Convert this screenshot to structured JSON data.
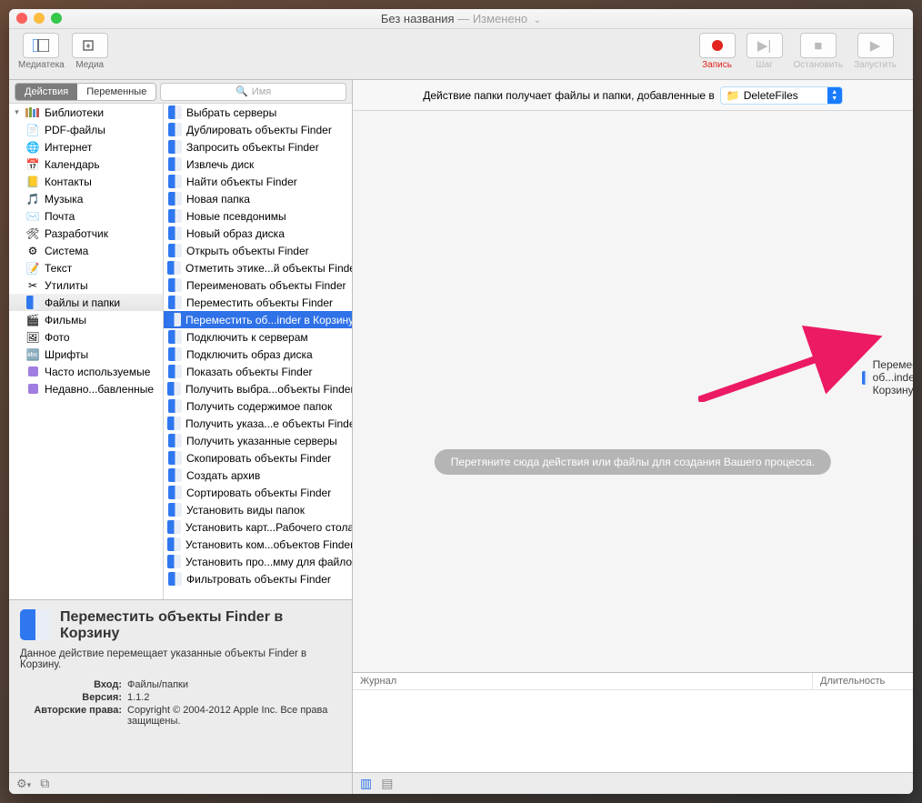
{
  "window": {
    "title": "Без названия",
    "subtitle": "— Изменено"
  },
  "toolbar": {
    "left": [
      {
        "id": "mediateka",
        "label": "Медиатека",
        "glyph": "layout"
      },
      {
        "id": "media",
        "label": "Медиа",
        "glyph": "media"
      }
    ],
    "right": [
      {
        "id": "record",
        "label": "Запись",
        "style": "rec"
      },
      {
        "id": "step",
        "label": "Шаг",
        "style": "dim"
      },
      {
        "id": "stop",
        "label": "Остановить",
        "style": "dim"
      },
      {
        "id": "run",
        "label": "Запустить",
        "style": "dim"
      }
    ]
  },
  "sidebar": {
    "tabs": {
      "actions": "Действия",
      "variables": "Переменные"
    },
    "search_placeholder": "Имя",
    "col1": {
      "header": "Библиотеки",
      "items": [
        {
          "label": "PDF-файлы",
          "ic": "📄"
        },
        {
          "label": "Интернет",
          "ic": "🌐"
        },
        {
          "label": "Календарь",
          "ic": "📅"
        },
        {
          "label": "Контакты",
          "ic": "📒"
        },
        {
          "label": "Музыка",
          "ic": "🎵"
        },
        {
          "label": "Почта",
          "ic": "✉️"
        },
        {
          "label": "Разработчик",
          "ic": "🛠"
        },
        {
          "label": "Система",
          "ic": "⚙"
        },
        {
          "label": "Текст",
          "ic": "📝"
        },
        {
          "label": "Утилиты",
          "ic": "✂"
        },
        {
          "label": "Файлы и папки",
          "ic": "finder",
          "selected": true
        },
        {
          "label": "Фильмы",
          "ic": "🎬"
        },
        {
          "label": "Фото",
          "ic": "🖼"
        },
        {
          "label": "Шрифты",
          "ic": "🔤"
        }
      ],
      "extra": [
        {
          "label": "Часто используемые"
        },
        {
          "label": "Недавно...бавленные"
        }
      ]
    },
    "col2": [
      "Выбрать серверы",
      "Дублировать объекты Finder",
      "Запросить объекты Finder",
      "Извлечь диск",
      "Найти объекты Finder",
      "Новая папка",
      "Новые псевдонимы",
      "Новый образ диска",
      "Открыть объекты Finder",
      "Отметить этике...й объекты Finder",
      "Переименовать объекты Finder",
      "Переместить объекты Finder",
      "Переместить об...inder в Корзину",
      "Подключить к серверам",
      "Подключить образ диска",
      "Показать объекты Finder",
      "Получить выбра...объекты Finder",
      "Получить содержимое папок",
      "Получить указа...е объекты Finder",
      "Получить указанные серверы",
      "Скопировать объекты Finder",
      "Создать архив",
      "Сортировать объекты Finder",
      "Установить виды папок",
      "Установить карт...Рабочего стола",
      "Установить ком...объектов Finder",
      "Установить про...мму для файлов",
      "Фильтровать объекты Finder"
    ],
    "col2_selected_index": 12
  },
  "detail": {
    "title": "Переместить объекты Finder в Корзину",
    "desc": "Данное действие перемещает указанные объекты Finder в Корзину.",
    "rows": [
      {
        "k": "Вход:",
        "v": "Файлы/папки"
      },
      {
        "k": "Версия:",
        "v": "1.1.2"
      },
      {
        "k": "Авторские права:",
        "v": "Copyright © 2004-2012 Apple Inc. Все права защищены."
      }
    ]
  },
  "workflow": {
    "header_text": "Действие папки получает файлы и папки, добавленные в",
    "folder": "DeleteFiles",
    "dragged_label": "Переместить об...inder в Корзину",
    "drop_hint": "Перетяните сюда действия или файлы для создания Вашего процесса."
  },
  "log": {
    "col1": "Журнал",
    "col2": "Длительность"
  }
}
